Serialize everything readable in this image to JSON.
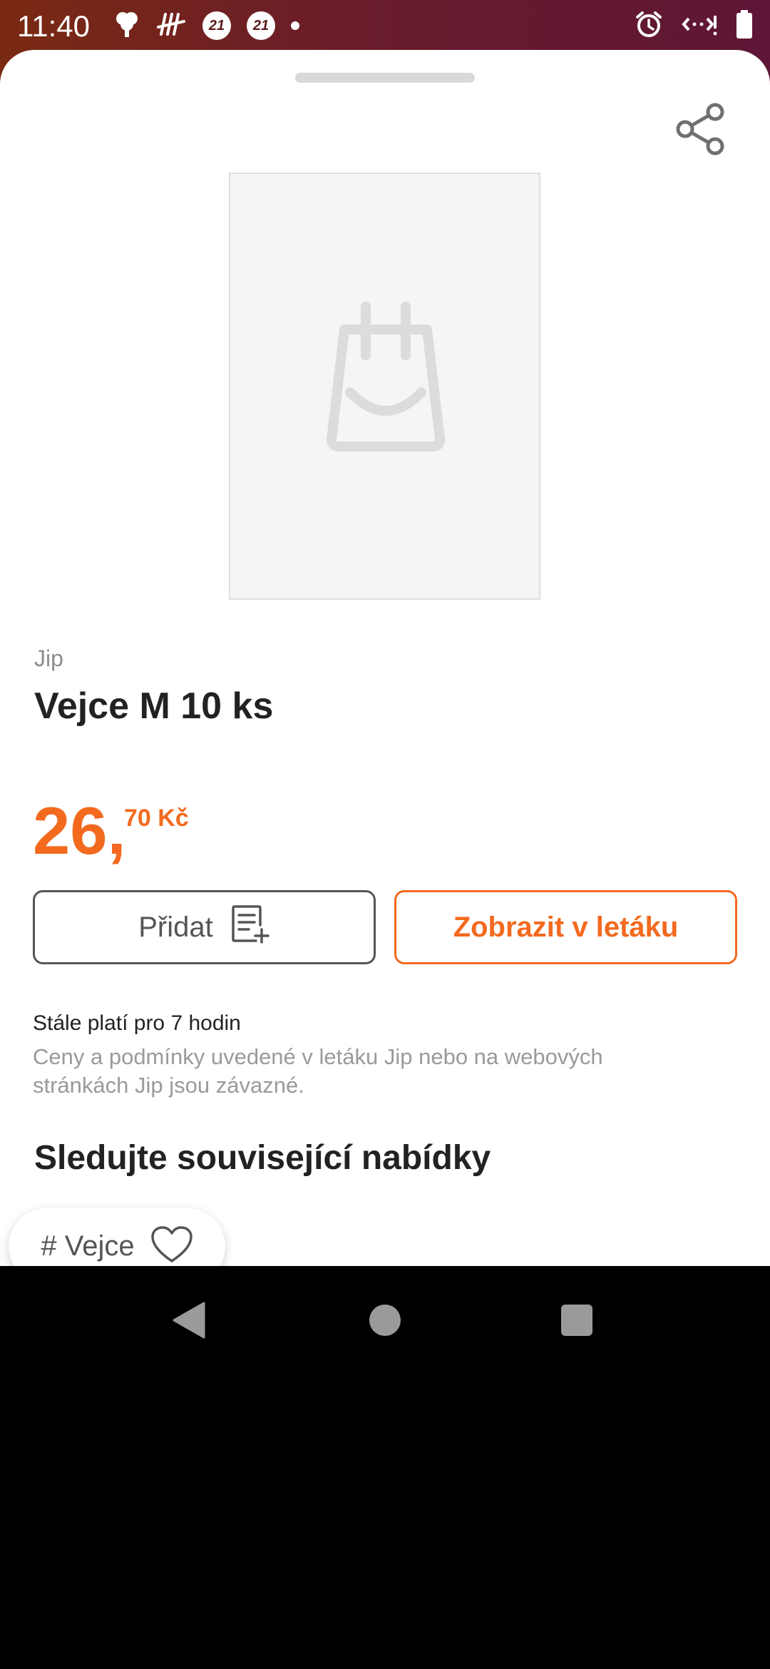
{
  "status_bar": {
    "time": "11:40",
    "badge1": "21",
    "badge2": "21"
  },
  "product": {
    "brand": "Jip",
    "title": "Vejce M 10 ks",
    "price_main": "26,",
    "price_cents": "70 Kč"
  },
  "actions": {
    "add_label": "Přidat",
    "flyer_label": "Zobrazit v letáku"
  },
  "info": {
    "validity": "Stále platí pro 7 hodin",
    "disclaimer": "Ceny a podmínky uvedené v letáku Jip nebo na webových stránkách Jip jsou závazné."
  },
  "related": {
    "title": "Sledujte související nabídky",
    "chip_label": "# Vejce"
  },
  "colors": {
    "accent": "#f36a1f",
    "text": "#222222",
    "muted": "#9a9a9a"
  },
  "icons": {
    "share": "share-icon",
    "placeholder": "shopping-bag-smile-icon",
    "add_list": "list-add-icon",
    "favorite": "heart-icon"
  }
}
